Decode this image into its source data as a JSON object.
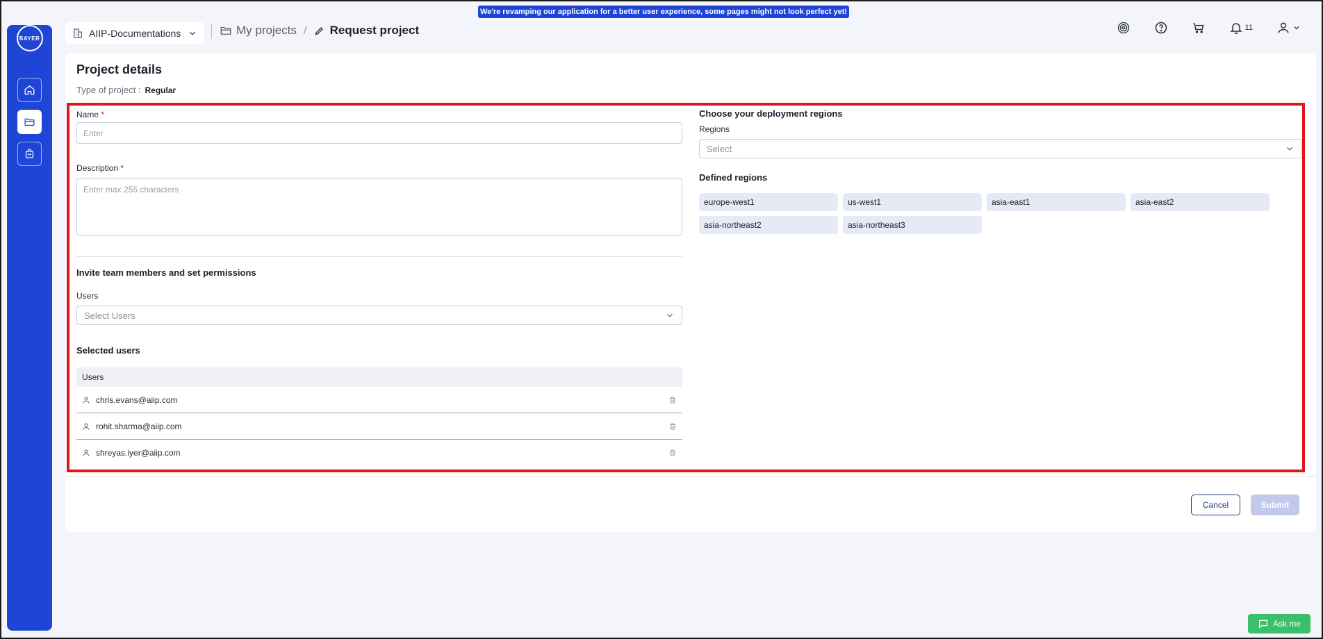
{
  "banner": {
    "text": "We're revamping our application for a better user experience, some pages might not look perfect yet!"
  },
  "logo": {
    "horizontal": "BAYER",
    "vertical": "BAYER"
  },
  "workspace": {
    "label": "AIIP-Documentations"
  },
  "breadcrumb": {
    "parent": "My projects",
    "separator": "/",
    "current": "Request project"
  },
  "topbar": {
    "notifications_count": "11"
  },
  "card": {
    "title": "Project details",
    "type_label": "Type of project :",
    "type_value": "Regular"
  },
  "form": {
    "name_label": "Name",
    "name_placeholder": "Enter",
    "required_mark": "*",
    "description_label": "Description",
    "description_placeholder": "Enter max 255 characters",
    "invite_title": "Invite team members and set permissions",
    "users_label": "Users",
    "users_placeholder": "Select Users",
    "selected_users_title": "Selected users",
    "table_header": "Users",
    "selected_users": [
      "chris.evans@aiip.com",
      "rohit.sharma@aiip.com",
      "shreyas.iyer@aiip.com"
    ]
  },
  "regions": {
    "title": "Choose your deployment regions",
    "label": "Regions",
    "placeholder": "Select",
    "defined_title": "Defined regions",
    "defined": [
      "europe-west1",
      "us-west1",
      "asia-east1",
      "asia-east2",
      "asia-northeast2",
      "asia-northeast3"
    ]
  },
  "actions": {
    "cancel": "Cancel",
    "submit": "Submit"
  },
  "assistant": {
    "label": "Ask me"
  },
  "colors": {
    "brand": "#1f45d6",
    "highlight": "#e0141e",
    "chip": "#e6e9f6",
    "assistant": "#3bbf6d"
  }
}
